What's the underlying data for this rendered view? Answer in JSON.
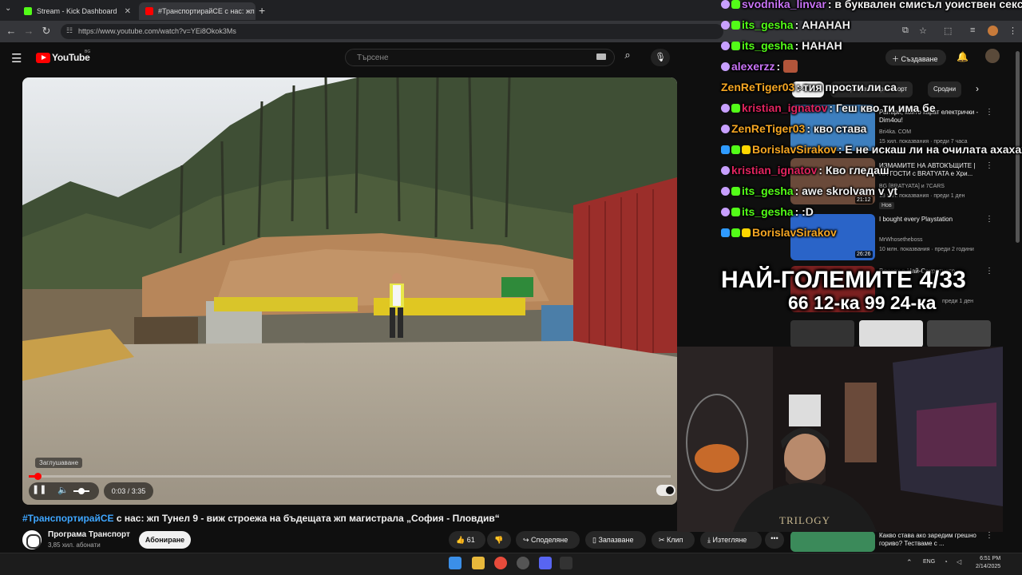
{
  "browser": {
    "tabs": [
      {
        "title": "Stream - Kick Dashboard",
        "favicon_color": "#53fc18"
      },
      {
        "title": "#ТранспортирайСЕ с нас: жп Т...",
        "favicon_color": "#ff0000"
      }
    ],
    "url": "https://www.youtube.com/watch?v=YEi8Okok3Ms"
  },
  "youtube": {
    "logo_text": "YouTube",
    "region": "BG",
    "search_placeholder": "Търсене",
    "create_label": "Създаване"
  },
  "player": {
    "mute_tooltip": "Заглушаване",
    "time": "0:03 / 3:35",
    "progress": 0.014
  },
  "video": {
    "title_tag": "#ТранспортирайСЕ",
    "title_rest": " с нас: жп Тунел 9 - виж строежа на бъдещата жп магистрала „София - Пловдив“",
    "channel": "Програма Транспорт",
    "subscribers": "3,85 хил. абонати",
    "subscribe_label": "Абониране",
    "likes": "61",
    "share_label": "Споделяне",
    "save_label": "Запазване",
    "clip_label": "Клип",
    "download_label": "Изтегляне"
  },
  "sidebar": {
    "chips": [
      "Всички",
      "От Програма Транспорт",
      "Сродни"
    ],
    "recommendations": [
      {
        "title": "Рапъри, които карат електрички - Dim4ou!",
        "channel": "Bri4ka. COM",
        "meta": "15 хил. показвания · преди 7 часа",
        "thumb_color": "#3d7fbf",
        "duration": ""
      },
      {
        "title": "ИЗМАМИТЕ НА АВТОКЪЩИТЕ | НА ГОСТИ с BRATYATA е Хри...",
        "channel": "BG [BRATYATA] и 7CARS",
        "meta": "13 хил. показвания · преди 1 ден",
        "thumb_color": "#6a4a3a",
        "duration": "21:12",
        "badge": "Нов"
      },
      {
        "title": "I bought every Playstation",
        "channel": "MrWhosetheboss",
        "meta": "10 млн. показвания · преди 2 години",
        "thumb_color": "#2a64c8",
        "duration": "26:26"
      },
      {
        "title": "Влязох в Най-Секретното...",
        "channel": "",
        "meta": "преди 1 ден",
        "thumb_color": "#7a2020",
        "duration": ""
      },
      {
        "title": "Какво става ако заредим грешно гориво? Тестваме с ...",
        "channel": "",
        "meta": "",
        "thumb_color": "#3b8a5a",
        "duration": ""
      }
    ]
  },
  "chat": [
    {
      "user": "svodnika_linvar",
      "color": "#c873f5",
      "msg": ": в буквален смисъл уоиствен секс",
      "badges": [
        "mod",
        "sub"
      ]
    },
    {
      "user": "its_gesha",
      "color": "#53fc18",
      "msg": ": АНАНАН",
      "badges": [
        "mod",
        "sub"
      ]
    },
    {
      "user": "its_gesha",
      "color": "#53fc18",
      "msg": ": НАНАН",
      "badges": [
        "mod",
        "sub"
      ]
    },
    {
      "user": "alexerzz",
      "color": "#c873f5",
      "msg": ":",
      "badges": [
        "mod"
      ],
      "emote": true
    },
    {
      "user": "ZenReTiger03",
      "color": "#f5a623",
      "msg": ": тия прости ли са",
      "badges": []
    },
    {
      "user": "kristian_ignatov",
      "color": "#e0245e",
      "msg": ": Геш кво ти има бе",
      "badges": [
        "mod",
        "sub"
      ]
    },
    {
      "user": "ZenReTiger03",
      "color": "#f5a623",
      "msg": ": кво става",
      "badges": [
        "mod"
      ]
    },
    {
      "user": "BorislavSirakov",
      "color": "#f5a623",
      "msg": ": Е не искаш ли на очилата ахахах",
      "badges": [
        "verified",
        "sub",
        "gift"
      ]
    },
    {
      "user": "kristian_ignatov",
      "color": "#e0245e",
      "msg": ": Кво гледаш",
      "badges": [
        "mod"
      ]
    },
    {
      "user": "its_gesha",
      "color": "#53fc18",
      "msg": ": awe skrolvam v yt",
      "badges": [
        "mod",
        "sub"
      ]
    },
    {
      "user": "its_gesha",
      "color": "#53fc18",
      "msg": ": :D",
      "badges": [
        "mod",
        "sub"
      ]
    },
    {
      "user": "BorislavSirakov",
      "color": "#f5a623",
      "msg": "",
      "badges": [
        "verified",
        "sub",
        "gift"
      ]
    }
  ],
  "overlay": {
    "big": "НАЙ-ГОЛЕМИТЕ 4/33",
    "small": "66 12-ка 99 24-ка"
  },
  "webcam": {
    "shirt_text": "TRILOGY"
  },
  "taskbar": {
    "lang": "ENG",
    "time": "6:51 PM",
    "date": "2/14/2025"
  }
}
